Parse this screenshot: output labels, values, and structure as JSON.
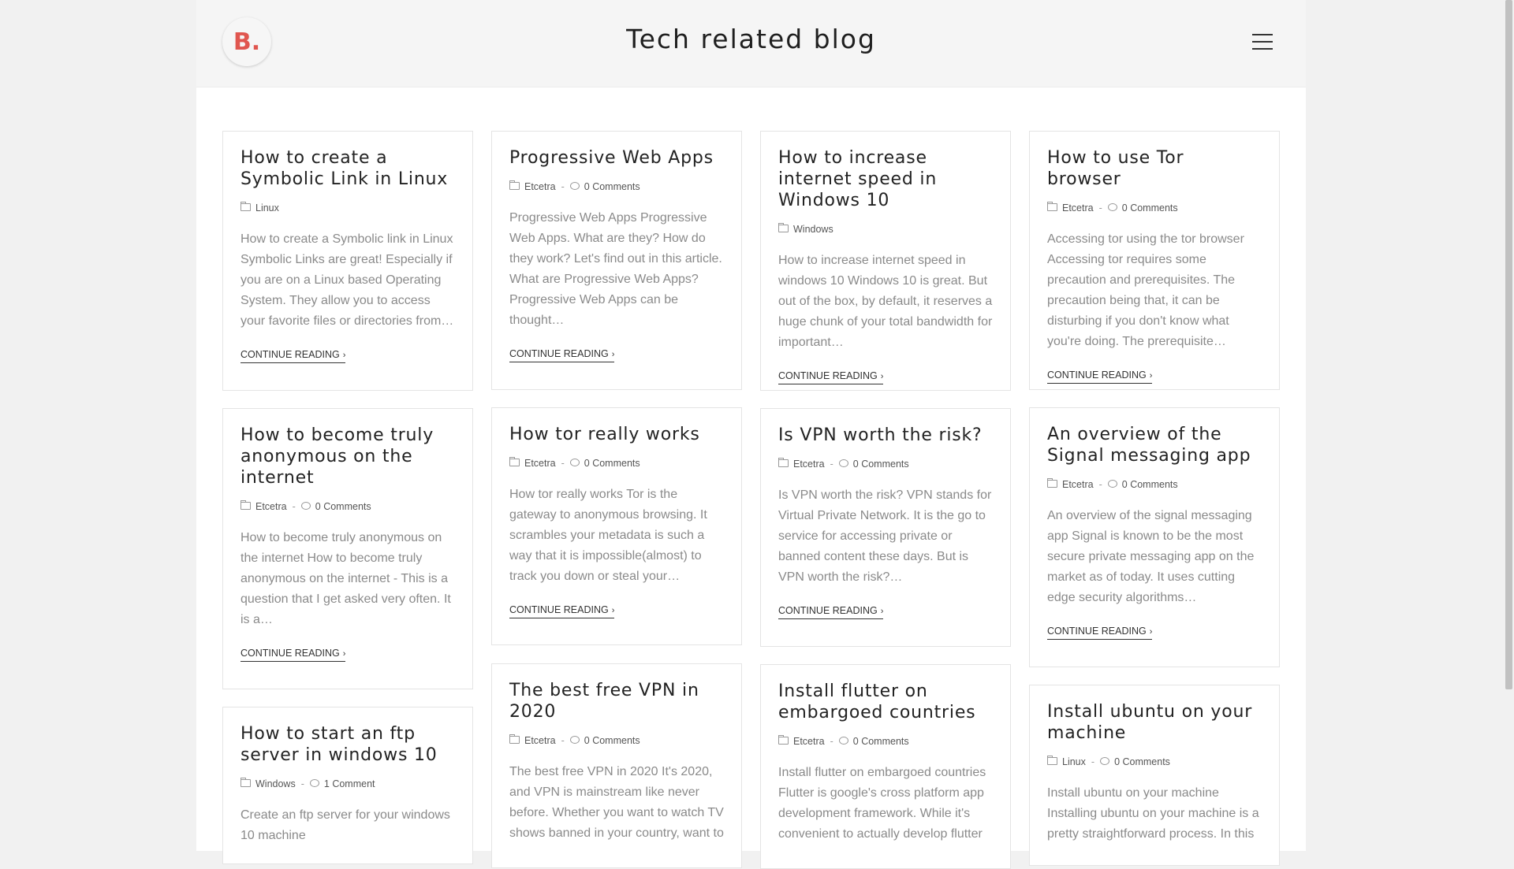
{
  "header": {
    "logo_text": "B.",
    "site_title": "Tech related blog",
    "menu_icon": "hamburger-menu-icon"
  },
  "posts": [
    {
      "title": "How to create a Symbolic Link in Linux",
      "category": "Linux",
      "comments": "",
      "excerpt": "How to create a Symbolic link in Linux Symbolic Links are great! Especially if you are on a Linux based Operating System. They allow you to access your favorite files or directories from…",
      "more": "CONTINUE READING"
    },
    {
      "title": "Progressive Web Apps",
      "category": "Etcetra",
      "comments": "0 Comments",
      "excerpt": "Progressive Web Apps Progressive Web Apps. What are they? How do they work? Let's find out in this article. What are Progressive Web Apps? Progressive Web Apps can be thought…",
      "more": "CONTINUE READING"
    },
    {
      "title": "How to increase internet speed in Windows 10",
      "category": "Windows",
      "comments": "",
      "excerpt": "How to increase internet speed in windows 10 Windows 10 is great. But out of the box, by default, it reserves a huge chunk of your total bandwidth for important…",
      "more": "CONTINUE READING"
    },
    {
      "title": "How to use Tor browser",
      "category": "Etcetra",
      "comments": "0 Comments",
      "excerpt": "Accessing tor using the tor browser Accessing tor requires some precaution and prerequisites. The precaution being that, it can be disturbing if you don't know what you're doing. The prerequisite…",
      "more": "CONTINUE READING"
    },
    {
      "title": "How to become truly anonymous on the internet",
      "category": "Etcetra",
      "comments": "0 Comments",
      "excerpt": "How to become truly anonymous on the internet How to become truly anonymous on the internet - This is a question that I get asked very often. It is a…",
      "more": "CONTINUE READING"
    },
    {
      "title": "How tor really works",
      "category": "Etcetra",
      "comments": "0 Comments",
      "excerpt": "How tor really works Tor is the gateway to anonymous browsing. It scrambles your metadata is such a way that it is impossible(almost) to track you down or steal your…",
      "more": "CONTINUE READING"
    },
    {
      "title": "Is VPN worth the risk?",
      "category": "Etcetra",
      "comments": "0 Comments",
      "excerpt": "Is VPN worth the risk? VPN stands for Virtual Private Network. It is the go to service for accessing private or banned content these days. But is VPN worth the risk?…",
      "more": "CONTINUE READING"
    },
    {
      "title": "An overview of the Signal messaging app",
      "category": "Etcetra",
      "comments": "0 Comments",
      "excerpt": "An overview of the signal messaging app Signal is known to be the most secure private messaging app on the market as of today. It uses cutting edge security algorithms…",
      "more": "CONTINUE READING"
    },
    {
      "title": "How to start an ftp server in windows 10",
      "category": "Windows",
      "comments": "1 Comment",
      "excerpt": "Create an ftp server for your windows 10 machine",
      "more": ""
    },
    {
      "title": "The best free VPN in 2020",
      "category": "Etcetra",
      "comments": "0 Comments",
      "excerpt": "The best free VPN in 2020 It's 2020, and VPN is mainstream like never before. Whether you want to watch TV shows banned in your country, want to",
      "more": ""
    },
    {
      "title": "Install flutter on embargoed countries",
      "category": "Etcetra",
      "comments": "0 Comments",
      "excerpt": "Install flutter on embargoed countries Flutter is google's cross platform app development framework. While it's convenient to actually develop flutter",
      "more": ""
    },
    {
      "title": "Install ubuntu on your machine",
      "category": "Linux",
      "comments": "0 Comments",
      "excerpt": "Install ubuntu on your machine Installing ubuntu on your machine is a pretty straightforward process. In this",
      "more": ""
    }
  ]
}
